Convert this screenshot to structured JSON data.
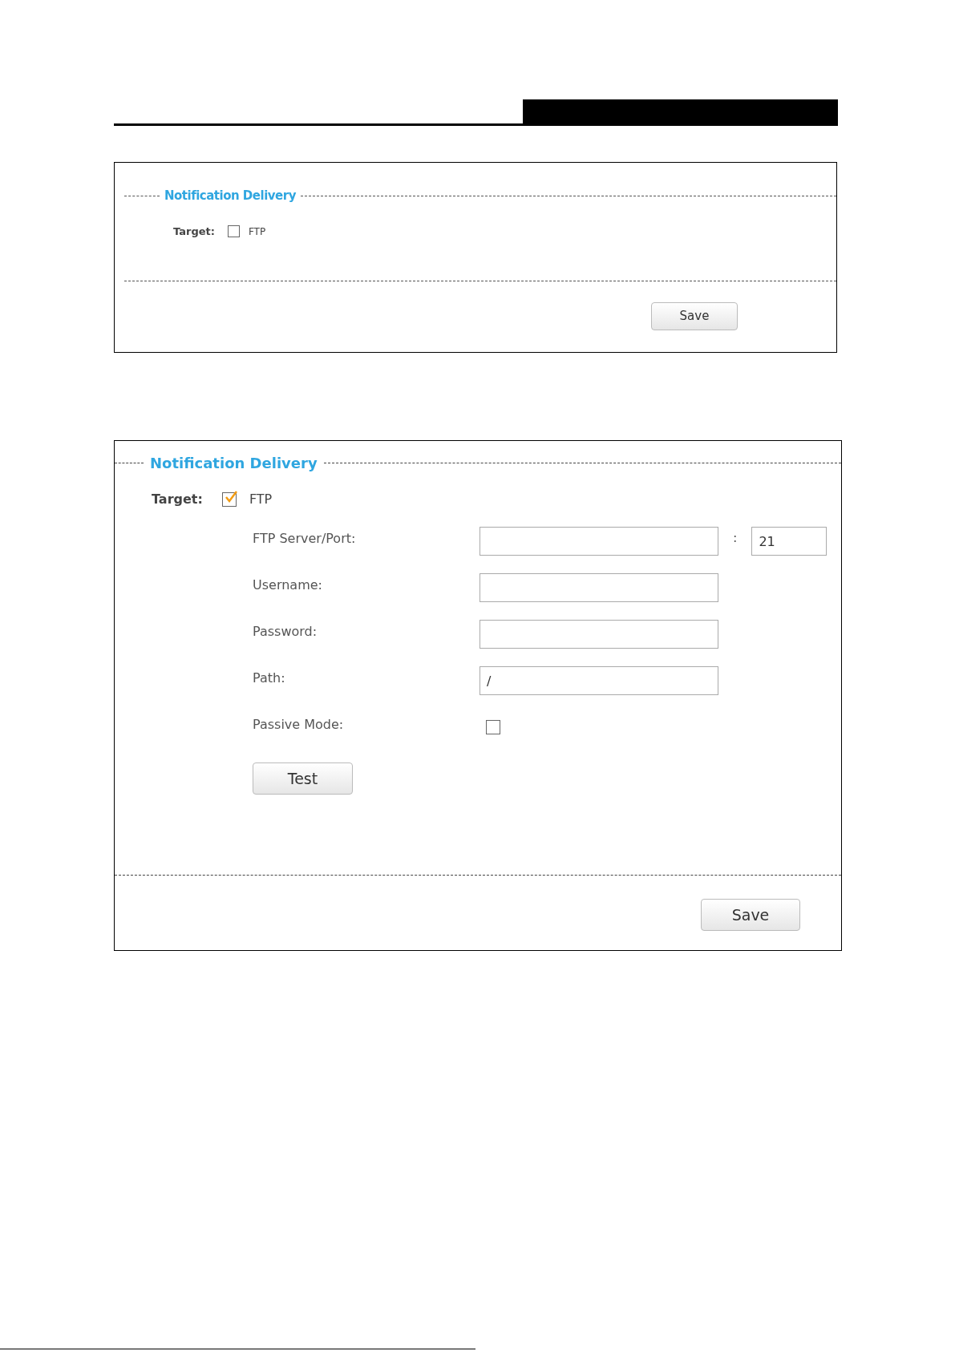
{
  "panels": [
    {
      "title": "Notification Delivery",
      "target_label": "Target:",
      "target_option": {
        "label": "FTP",
        "checked": false
      },
      "save_button": "Save"
    },
    {
      "title": "Notification Delivery",
      "target_label": "Target:",
      "target_option": {
        "label": "FTP",
        "checked": true
      },
      "fields": [
        {
          "kind": "server",
          "label": "FTP Server/Port:",
          "separator": ":",
          "port": "21"
        },
        {
          "kind": "text",
          "label": "Username:"
        },
        {
          "kind": "text",
          "label": "Password:"
        },
        {
          "kind": "text",
          "label": "Path:",
          "value": "/"
        },
        {
          "kind": "checkbox",
          "label": "Passive Mode:",
          "checked": false
        }
      ],
      "test_button": "Test",
      "save_button": "Save"
    }
  ]
}
